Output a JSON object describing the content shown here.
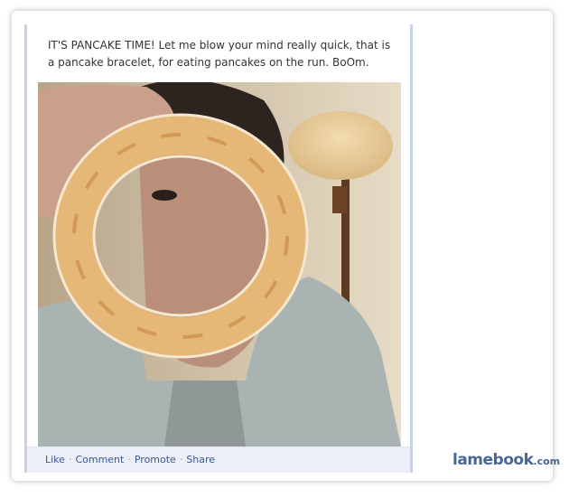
{
  "post": {
    "text": "IT'S PANCAKE TIME! Let me blow your mind really quick, that is a pancake bracelet, for eating pancakes on the run. BoOm."
  },
  "actions": {
    "like": "Like",
    "comment": "Comment",
    "promote": "Promote",
    "share": "Share",
    "separator": "·"
  },
  "brand": {
    "name": "lamebook",
    "tld": ".com"
  },
  "colors": {
    "link": "#3b5998",
    "brand": "#4a6699",
    "action_bar": "#eceff5"
  }
}
